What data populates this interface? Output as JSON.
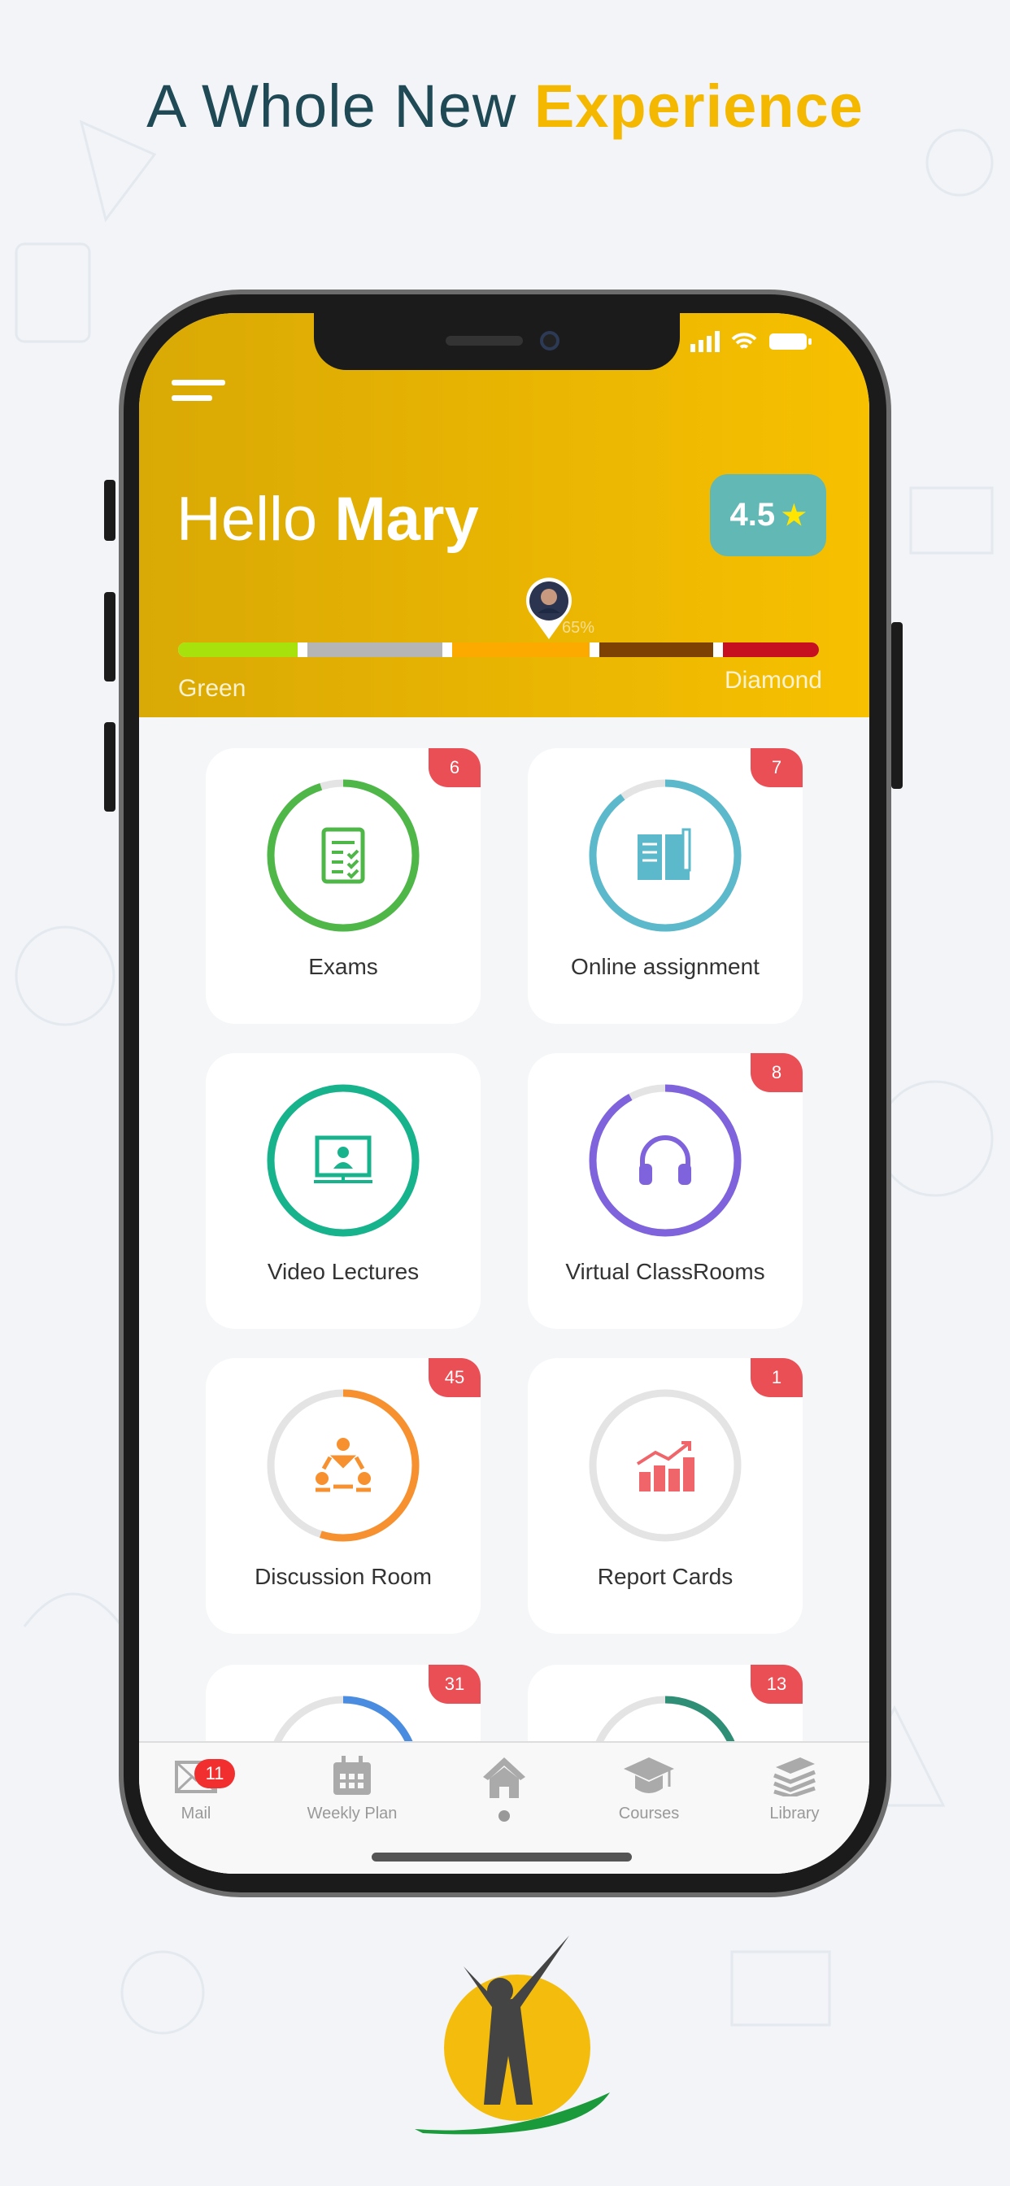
{
  "headline": {
    "regular": "A Whole New",
    "bold": "Experience",
    "accent": "#f5b800"
  },
  "header": {
    "greeting": "Hello",
    "name": "Mary",
    "rating": "4.5",
    "rating_icon": "star-icon",
    "progress_percent": "65%",
    "progress": 0.65,
    "level_start": "Green",
    "level_end": "Diamond",
    "bg": "#e6b000",
    "levels": [
      {
        "color": "#a7e20c"
      },
      {
        "color": "#b5b5b5"
      },
      {
        "color": "#fca900"
      },
      {
        "color": "#7c4103"
      },
      {
        "color": "#c60f1f"
      }
    ]
  },
  "cards": [
    {
      "label": "Exams",
      "badge": "6",
      "color": "#4fb748",
      "progress": 0.95,
      "icon": "exam-document-icon"
    },
    {
      "label": "Online assignment",
      "badge": "7",
      "color": "#5bb9cb",
      "progress": 0.9,
      "icon": "open-book-pencil-icon"
    },
    {
      "label": "Video Lectures",
      "badge": "",
      "color": "#17b38c",
      "progress": 1.0,
      "icon": "video-lecture-icon"
    },
    {
      "label": "Virtual ClassRooms",
      "badge": "8",
      "color": "#7e63dc",
      "progress": 0.92,
      "icon": "headphones-icon"
    },
    {
      "label": "Discussion Room",
      "badge": "45",
      "color": "#f7912f",
      "progress": 0.55,
      "icon": "discussion-group-icon"
    },
    {
      "label": "Report Cards",
      "badge": "1",
      "color": "#f0656a",
      "progress": 0.0,
      "icon": "bar-chart-icon"
    },
    {
      "label": "",
      "badge": "31",
      "color": "#4a8de0",
      "progress": 0.4,
      "icon": ""
    },
    {
      "label": "",
      "badge": "13",
      "color": "#2e8e76",
      "progress": 0.3,
      "icon": ""
    }
  ],
  "tabbar": {
    "mail": "Mail",
    "mail_badge": "11",
    "weekly": "Weekly Plan",
    "courses": "Courses",
    "library": "Library"
  }
}
